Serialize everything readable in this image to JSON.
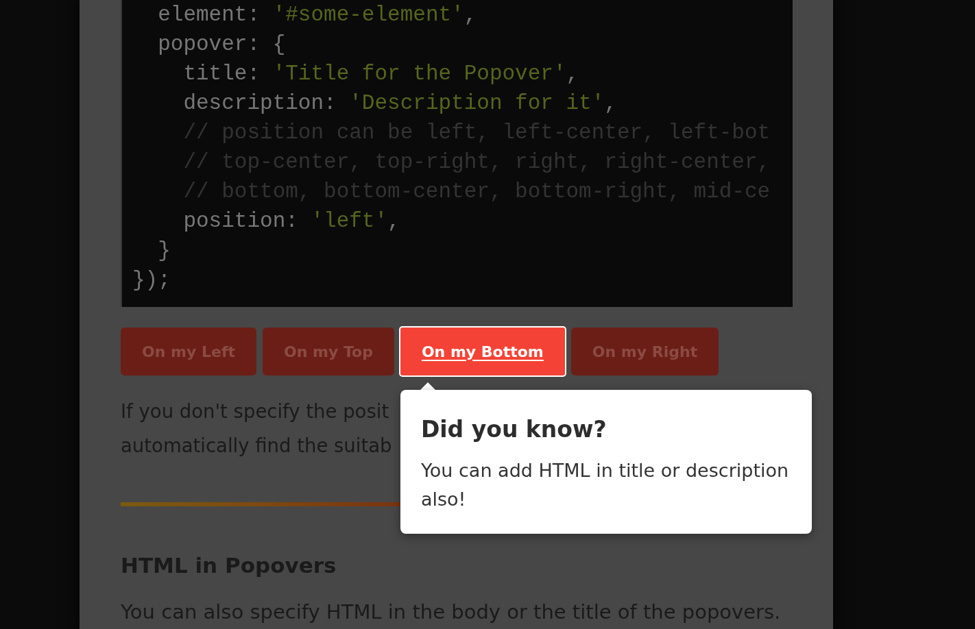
{
  "code_block": {
    "lines": [
      {
        "segments": [
          {
            "kind": "plain",
            "text": "  element: "
          },
          {
            "kind": "string",
            "text": "'#some-element'"
          },
          {
            "kind": "plain",
            "text": ","
          }
        ]
      },
      {
        "segments": [
          {
            "kind": "plain",
            "text": "  popover: {"
          }
        ]
      },
      {
        "segments": [
          {
            "kind": "plain",
            "text": "    title: "
          },
          {
            "kind": "string",
            "text": "'Title for the Popover'"
          },
          {
            "kind": "plain",
            "text": ","
          }
        ]
      },
      {
        "segments": [
          {
            "kind": "plain",
            "text": "    description: "
          },
          {
            "kind": "string",
            "text": "'Description for it'"
          },
          {
            "kind": "plain",
            "text": ","
          }
        ]
      },
      {
        "segments": [
          {
            "kind": "comment",
            "text": "    // position can be left, left-center, left-bot"
          }
        ]
      },
      {
        "segments": [
          {
            "kind": "comment",
            "text": "    // top-center, top-right, right, right-center,"
          }
        ]
      },
      {
        "segments": [
          {
            "kind": "comment",
            "text": "    // bottom, bottom-center, bottom-right, mid-ce"
          }
        ]
      },
      {
        "segments": [
          {
            "kind": "plain",
            "text": "    position: "
          },
          {
            "kind": "string",
            "text": "'left'"
          },
          {
            "kind": "plain",
            "text": ","
          }
        ]
      },
      {
        "segments": [
          {
            "kind": "plain",
            "text": "  }"
          }
        ]
      },
      {
        "segments": [
          {
            "kind": "plain",
            "text": "});"
          }
        ]
      }
    ]
  },
  "position_buttons": [
    {
      "label": "On my Left",
      "selected": false
    },
    {
      "label": "On my Top",
      "selected": false
    },
    {
      "label": "On my Bottom",
      "selected": true
    },
    {
      "label": "On my Right",
      "selected": false
    }
  ],
  "intro_paragraph": {
    "lines": [
      "If you don't specify the posit",
      "automatically find the suitab"
    ]
  },
  "popover": {
    "title": "Did you know?",
    "description": "You can add HTML in title or description also!"
  },
  "section": {
    "heading": "HTML in Popovers",
    "text": "You can also specify HTML in the body or the title of the popovers."
  }
}
